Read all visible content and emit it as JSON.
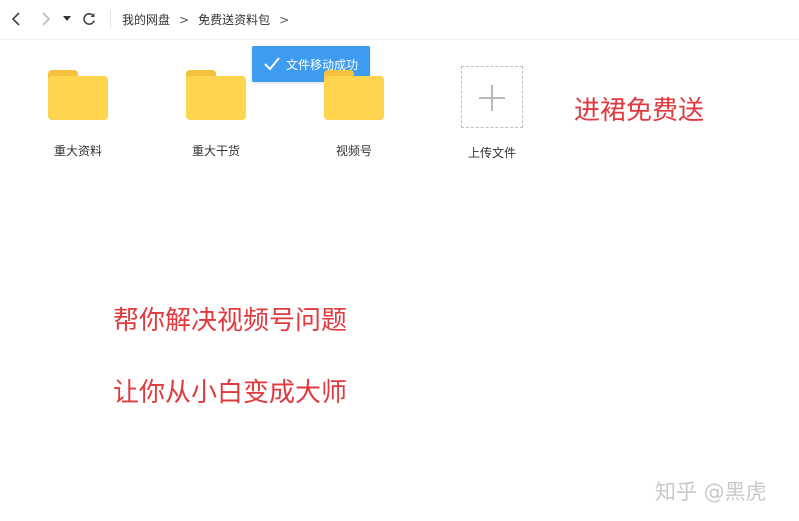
{
  "breadcrumb": {
    "items": [
      "我的网盘",
      "免费送资料包"
    ],
    "separator": ">"
  },
  "toast": {
    "message": "文件移动成功"
  },
  "files": [
    {
      "name": "重大资料",
      "type": "folder"
    },
    {
      "name": "重大干货",
      "type": "folder"
    },
    {
      "name": "视频号",
      "type": "folder"
    }
  ],
  "upload": {
    "label": "上传文件"
  },
  "overlay": {
    "line1": "进裙免费送",
    "line2": "帮你解决视频号问题",
    "line3": "让你从小白变成大师"
  },
  "watermark": "知乎 @黑虎",
  "colors": {
    "accent": "#3d9cf0",
    "folder": "#ffd54f",
    "overlay_red": "#e0393e"
  },
  "icons": [
    "back-arrow-icon",
    "forward-arrow-icon",
    "dropdown-caret-icon",
    "refresh-icon",
    "check-icon",
    "folder-icon",
    "plus-icon"
  ]
}
